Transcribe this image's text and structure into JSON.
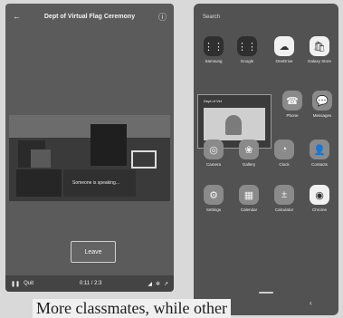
{
  "left_phone": {
    "header_title": "Dept of Virtual Flag Ceremony",
    "back_icon": "back-arrow-icon",
    "info_icon": "info-icon",
    "caption": "Someone is speaking...",
    "leave_label": "Leave",
    "footer_left": "Quit",
    "footer_center": "0:11 / 2:3",
    "footer_icons": [
      "volume-icon",
      "settings-icon",
      "expand-icon"
    ]
  },
  "right_phone": {
    "search_label": "Search",
    "apps_row1": [
      {
        "label": "Samsung",
        "icon": "grid-icon"
      },
      {
        "label": "Google",
        "icon": "grid-icon"
      },
      {
        "label": "OneDrive",
        "icon": "cloud-icon"
      },
      {
        "label": "Galaxy Store",
        "icon": "shopping-bag-icon"
      }
    ],
    "preview_title": "Dept of Virt",
    "apps_row2": [
      {
        "label": "Phone",
        "icon": "phone-icon"
      },
      {
        "label": "Messages",
        "icon": "chat-icon"
      }
    ],
    "apps_row3": [
      {
        "label": "Camera",
        "icon": "camera-icon"
      },
      {
        "label": "Gallery",
        "icon": "gallery-icon"
      },
      {
        "label": "Clock",
        "icon": "clock-icon"
      },
      {
        "label": "Contacts",
        "icon": "contacts-icon"
      }
    ],
    "apps_row4": [
      {
        "label": "Settings",
        "icon": "gear-icon"
      },
      {
        "label": "Calendar",
        "icon": "calendar-icon"
      },
      {
        "label": "Calculator",
        "icon": "calculator-icon"
      },
      {
        "label": "Chrome",
        "icon": "chrome-icon"
      }
    ]
  },
  "bottom_text": "More classmates, while other"
}
